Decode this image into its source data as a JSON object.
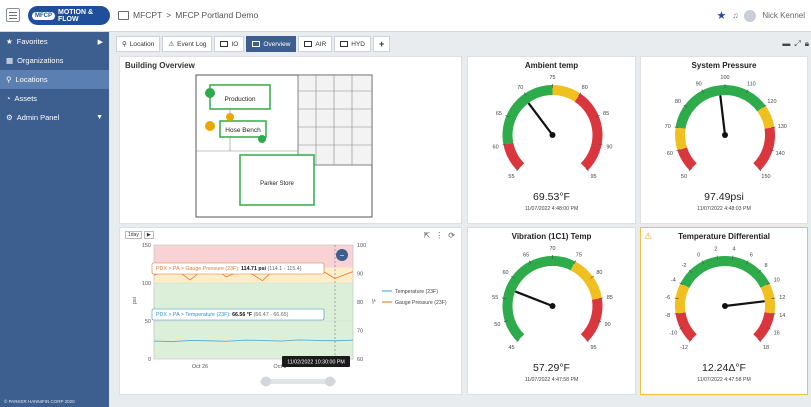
{
  "topbar": {
    "logo_mark": "MFCP",
    "logo_text": "MOTION & FLOW",
    "breadcrumb_root": "MFCPT",
    "breadcrumb_sep": ">",
    "breadcrumb_current": "MFCP Portland Demo",
    "user": "Nick Kennel"
  },
  "sidebar": {
    "items": [
      {
        "label": "Favorites"
      },
      {
        "label": "Organizations"
      },
      {
        "label": "Locations"
      },
      {
        "label": "Assets"
      },
      {
        "label": "Admin Panel"
      }
    ],
    "copyright": "© PARKER HANNIFIN CORP 2020"
  },
  "tabs": [
    {
      "label": "Location"
    },
    {
      "label": "Event Log"
    },
    {
      "label": "IO"
    },
    {
      "label": "Overview"
    },
    {
      "label": "AIR"
    },
    {
      "label": "HYD"
    },
    {
      "label": "+"
    }
  ],
  "building": {
    "title": "Building Overview",
    "rooms": [
      "Production",
      "Hose Bench",
      "Parker Store"
    ]
  },
  "gauges": [
    {
      "title": "Ambient temp",
      "value": "69.53°F",
      "time": "11/07/2022 4:48:00 PM",
      "min": 55,
      "max": 95,
      "val": 69.53,
      "ticks": [
        55,
        60,
        65,
        70,
        75,
        80,
        85,
        90,
        95
      ],
      "zones": [
        [
          "#d9363e",
          55,
          60
        ],
        [
          "#2eab4a",
          60,
          75
        ],
        [
          "#f0c020",
          75,
          80
        ],
        [
          "#d9363e",
          80,
          95
        ]
      ]
    },
    {
      "title": "System Pressure",
      "value": "97.49psi",
      "time": "11/07/2022 4:48:03 PM",
      "min": 50,
      "max": 150,
      "val": 97.49,
      "ticks": [
        50,
        60,
        70,
        80,
        90,
        100,
        110,
        120,
        130,
        140,
        150
      ],
      "zones": [
        [
          "#d9363e",
          50,
          60
        ],
        [
          "#f0c020",
          60,
          70
        ],
        [
          "#2eab4a",
          70,
          120
        ],
        [
          "#f0c020",
          120,
          130
        ],
        [
          "#d9363e",
          130,
          150
        ]
      ]
    },
    {
      "title": "Vibration (1C1) Temp",
      "value": "57.29°F",
      "time": "11/07/2022 4:47:58 PM",
      "min": 45,
      "max": 95,
      "val": 57.29,
      "ticks": [
        45,
        50,
        55,
        60,
        65,
        70,
        75,
        80,
        85,
        90,
        95
      ],
      "zones": [
        [
          "#2eab4a",
          45,
          75
        ],
        [
          "#f0c020",
          75,
          85
        ],
        [
          "#d9363e",
          85,
          95
        ]
      ]
    },
    {
      "title": "Temperature Differential",
      "value": "12.24Δ°F",
      "time": "11/07/2022 4:47:58 PM",
      "min": -12,
      "max": 18,
      "val": 12.24,
      "ticks": [
        -12,
        -10,
        -8,
        -6,
        -4,
        -2,
        0,
        2,
        4,
        6,
        8,
        10,
        12,
        14,
        16,
        18
      ],
      "zones": [
        [
          "#d9363e",
          -12,
          -8
        ],
        [
          "#f0c020",
          -8,
          -4
        ],
        [
          "#2eab4a",
          -4,
          10
        ],
        [
          "#f0c020",
          10,
          14
        ],
        [
          "#d9363e",
          14,
          18
        ]
      ]
    }
  ],
  "chart": {
    "range_label": "1day",
    "tooltip1_label": "PDX > PA > Gauge Pressure (23F):",
    "tooltip1_value": "114.71 psi",
    "tooltip1_range": "(114.1 - 115.4)",
    "tooltip2_label": "PDX > PA > Temperature (23F):",
    "tooltip2_value": "66.56 °F",
    "tooltip2_range": "(66.47 - 66.65)",
    "hover_time": "11/02/2022 10:30:00 PM",
    "left_axis_label": "psi",
    "right_axis_label": "°F",
    "accent": "#3c5f8f"
  },
  "chart_data": {
    "type": "line",
    "x_ticks": [
      "Oct 26",
      "Oct 3"
    ],
    "y_left_ticks": [
      0,
      50,
      100,
      150
    ],
    "y_right_ticks": [
      60,
      70,
      80,
      90,
      100
    ],
    "series": [
      {
        "name": "Temperature (23F)",
        "color": "#5aaed6",
        "values": [
          66.3,
          66.1,
          66.5,
          66.4,
          66.2,
          66.6,
          66.5,
          66.3,
          66.7,
          66.5,
          66.4,
          66.6
        ]
      },
      {
        "name": "Gauge Pressure (23F)",
        "color": "#f0803c",
        "values": [
          110,
          121,
          104,
          124,
          108,
          118,
          103,
          126,
          112,
          120,
          106,
          115
        ]
      }
    ]
  }
}
